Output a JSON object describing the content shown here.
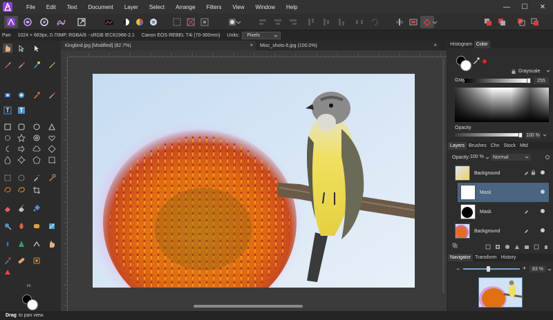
{
  "menu": {
    "items": [
      "File",
      "Edit",
      "Text",
      "Document",
      "Layer",
      "Select",
      "Arrange",
      "Filters",
      "View",
      "Window",
      "Help"
    ],
    "minimize": "—",
    "maximize": "☐",
    "close": "✕"
  },
  "context_bar": {
    "tool": "Pan",
    "info": "1024 × 683px, 0.70MP, RGBA/8 - sRGB IEC61966-2.1",
    "camera": "Canon EOS REBEL T4i (70-300mm)",
    "units_label": "Units:",
    "units_value": "Pixels"
  },
  "tabs": [
    {
      "label": "Kingbird.jpg [Modified] (82.7%)",
      "close": "×"
    },
    {
      "label": "Misc_shots-6.jpg (100.0%)",
      "close": "×"
    }
  ],
  "color_panel": {
    "tabs": [
      "Histogram",
      "Color"
    ],
    "mode": "Grayscale",
    "gray_label": "Gray:",
    "gray_value": "255",
    "opacity_label": "Opacity",
    "opacity_value": "100 %"
  },
  "layers_panel": {
    "tabs": [
      "Layers",
      "Brushes",
      "Chn",
      "Stock",
      "Mtd"
    ],
    "opacity_label": "Opacity:",
    "opacity_value": "100 %",
    "blend_mode": "Normal",
    "layers": [
      {
        "name": "Background"
      },
      {
        "name": "Mask"
      },
      {
        "name": "Mask"
      },
      {
        "name": "Background"
      }
    ]
  },
  "navigator_panel": {
    "tabs": [
      "Navigator",
      "Transform",
      "History"
    ],
    "zoom_value": "83 %",
    "minus": "−",
    "plus": "+"
  },
  "status": {
    "action": "Drag",
    "message": "to pan view."
  },
  "colors": {
    "accent": "#8b3fd1",
    "selection": "#4a6481",
    "background": "#2b2b2b"
  }
}
